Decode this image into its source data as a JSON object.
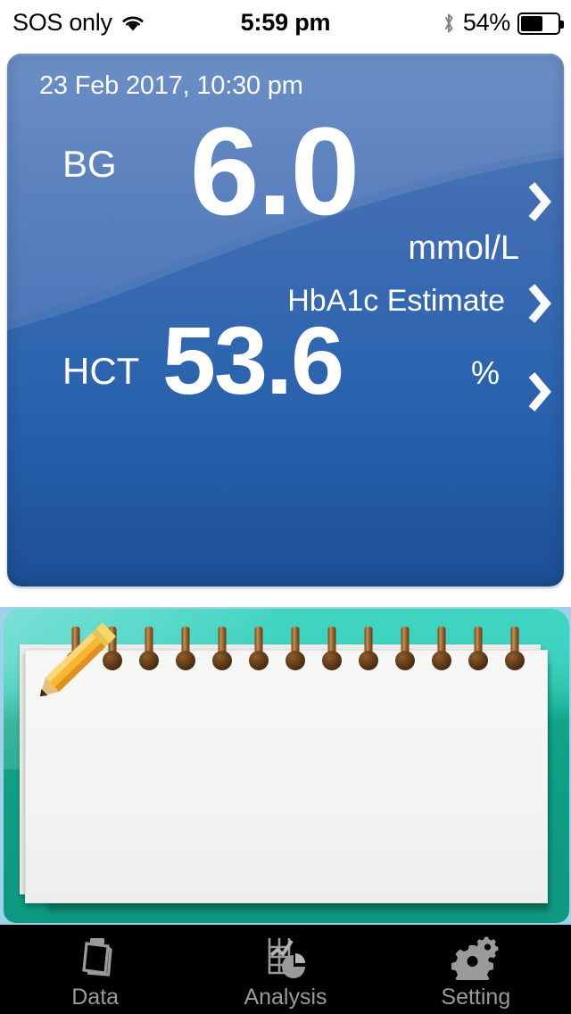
{
  "status_bar": {
    "carrier": "SOS only",
    "wifi_icon": "wifi-icon",
    "time": "5:59 pm",
    "bluetooth_icon": "bluetooth-icon",
    "battery_percent": "54%",
    "battery_level": 54
  },
  "reading_card": {
    "timestamp": "23 Feb 2017, 10:30 pm",
    "bg": {
      "label": "BG",
      "value": "6.0",
      "unit": "mmol/L",
      "chevron": "chevron-right-icon"
    },
    "hba1c": {
      "label": "HbA1c Estimate",
      "chevron": "chevron-right-icon"
    },
    "hct": {
      "label": "HCT",
      "value": "53.6",
      "unit": "%",
      "chevron": "chevron-right-icon"
    },
    "colors": {
      "card_top": "#4f79b8",
      "card_bottom": "#1c4f96",
      "wave_light": "#5d83bd",
      "text": "#ffffff"
    }
  },
  "notepad": {
    "note_text": "",
    "ring_count": 13,
    "pencil_icon": "pencil-icon",
    "colors": {
      "frame_top": "#3fd4c2",
      "frame_bottom": "#0e9880",
      "paper": "#f7f7f5",
      "edge": "#9ed2ea"
    }
  },
  "tabbar": {
    "background": "#000000",
    "label_color": "#9a9a9a",
    "tabs": [
      {
        "label": "Data",
        "icon": "documents-stack-icon"
      },
      {
        "label": "Analysis",
        "icon": "chart-pie-icon"
      },
      {
        "label": "Setting",
        "icon": "gears-icon"
      }
    ]
  }
}
